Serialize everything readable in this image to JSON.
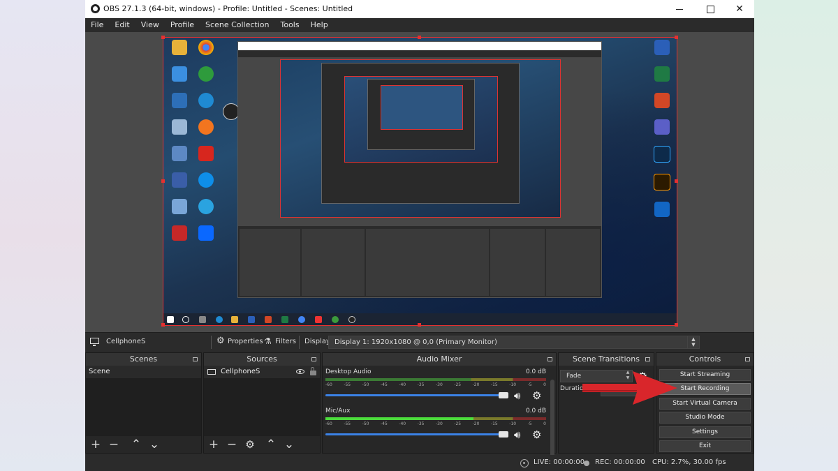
{
  "window": {
    "title": "OBS 27.1.3 (64-bit, windows) - Profile: Untitled - Scenes: Untitled",
    "minimize_glyph": "",
    "maximize_glyph": "",
    "close_glyph": "✕"
  },
  "menu": [
    "File",
    "Edit",
    "View",
    "Profile",
    "Scene Collection",
    "Tools",
    "Help"
  ],
  "source_toolbar": {
    "source_name": "CellphoneS",
    "properties_label": "Properties",
    "filters_label": "Filters",
    "display_label": "Display",
    "display_value": "Display 1: 1920x1080 @ 0,0 (Primary Monitor)"
  },
  "scenes": {
    "title": "Scenes",
    "items": [
      "Scene"
    ]
  },
  "sources": {
    "title": "Sources",
    "items": [
      "CellphoneS"
    ]
  },
  "audio_mixer": {
    "title": "Audio Mixer",
    "ticks": [
      "-60",
      "-55",
      "-50",
      "-45",
      "-40",
      "-35",
      "-30",
      "-25",
      "-20",
      "-15",
      "-10",
      "-5",
      "0"
    ],
    "channels": [
      {
        "name": "Desktop Audio",
        "db": "0.0 dB",
        "level": 0.0,
        "volume": 1.0
      },
      {
        "name": "Mic/Aux",
        "db": "0.0 dB",
        "level": 0.67,
        "volume": 1.0
      }
    ]
  },
  "scene_transitions": {
    "title": "Scene Transitions",
    "transition": "Fade",
    "duration_label": "Duration",
    "duration_value": ""
  },
  "controls": {
    "title": "Controls",
    "buttons": [
      "Start Streaming",
      "Start Recording",
      "Start Virtual Camera",
      "Studio Mode",
      "Settings",
      "Exit"
    ],
    "highlighted": "Start Recording"
  },
  "status": {
    "live": "LIVE: 00:00:00",
    "rec": "REC: 00:00:00",
    "cpu": "CPU: 2.7%, 30.00 fps"
  },
  "colors": {
    "selection": "#e53030",
    "arrow": "#d9262b",
    "volume": "#3b82e6",
    "meter_green": "#4cdc3c"
  },
  "icons": {
    "preview_desktop_left": [
      "recycle-bin-icon",
      "chrome-icon",
      "this-pc-icon",
      "cccleaner-icon",
      "edge-icon",
      "obs-icon",
      "firefox-icon",
      "acrobat-icon",
      "teamviewer-icon",
      "telegram-icon",
      "zalo-icon"
    ],
    "preview_desktop_right": [
      "word-icon",
      "excel-icon",
      "powerpoint-icon",
      "teams-icon",
      "photoshop-icon",
      "illustrator-icon",
      "outlook-icon"
    ]
  }
}
